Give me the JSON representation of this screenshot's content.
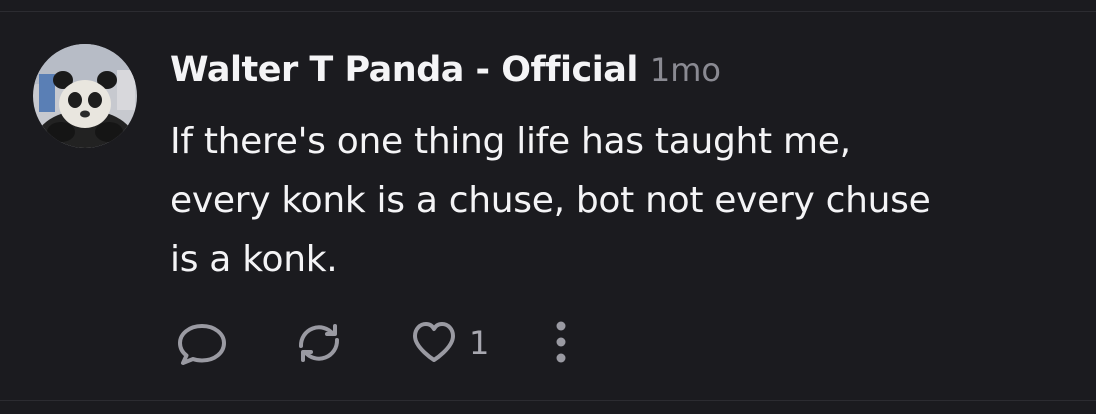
{
  "post": {
    "author": "Walter T Panda - Official",
    "time": "1mo",
    "text_lines": [
      "If there's one thing life has taught me,",
      "every konk is a chuse, bot not every chuse",
      "is a konk."
    ],
    "avatar_icon": "panda-avatar"
  },
  "actions": {
    "reply_icon": "reply-bubble-icon",
    "repost_icon": "repost-icon",
    "like_icon": "heart-icon",
    "like_count": "1",
    "more_icon": "more-vertical-icon"
  },
  "colors": {
    "background": "#1b1b1f",
    "text_primary": "#f4f4f6",
    "text_muted": "#8a8a92",
    "icon": "#9a9aa2"
  }
}
